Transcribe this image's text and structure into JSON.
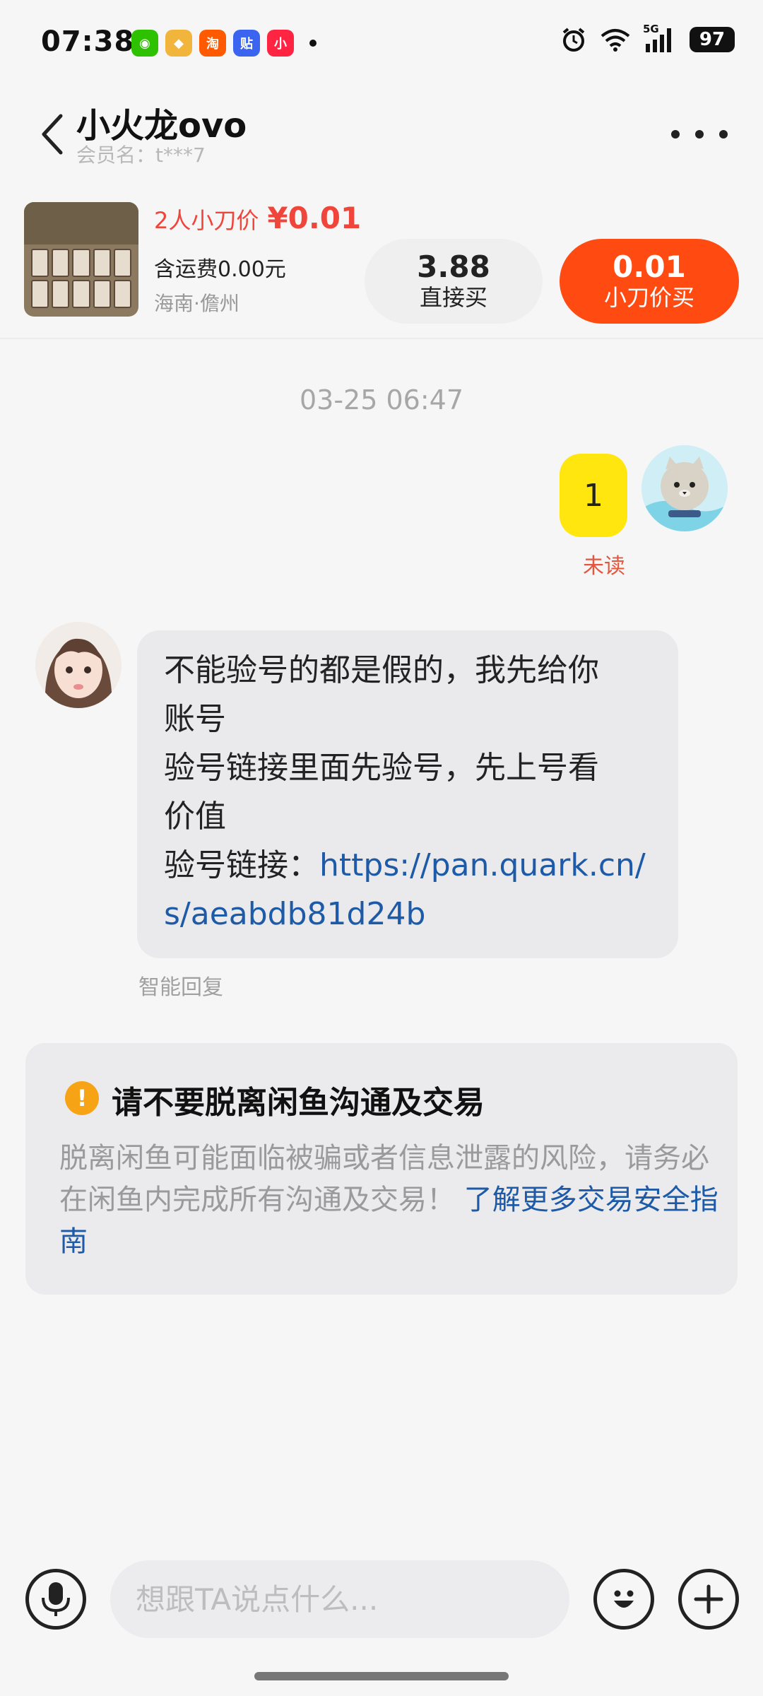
{
  "status_bar": {
    "time": "07:38",
    "apps": [
      {
        "icon": "wechat-icon",
        "color": "#2dc100",
        "glyph": "◉"
      },
      {
        "icon": "game-app-icon",
        "color": "#e94b3c",
        "glyph": "◆"
      },
      {
        "icon": "taobao-icon",
        "color": "#ff5a00",
        "glyph": "淘"
      },
      {
        "icon": "tieba-icon",
        "color": "#3b64f0",
        "glyph": "贴"
      },
      {
        "icon": "xiaohongshu-icon",
        "color": "#ff2442",
        "glyph": "小"
      }
    ],
    "network": "5G",
    "battery": "97"
  },
  "header": {
    "seller_name": "小火龙ovo",
    "member_label": "会员名：",
    "member_id": "t***7"
  },
  "product": {
    "bargain_label": "2人小刀价",
    "bargain_price": "¥0.01",
    "shipping": "含运费0.00元",
    "location": "海南·儋州",
    "direct_price": "3.88",
    "direct_label": "直接买",
    "bargain_button_price": "0.01",
    "bargain_button_label": "小刀价买"
  },
  "chat": {
    "timestamp": "03-25 06:47",
    "my_message": "1",
    "unread": "未读",
    "their_lines": [
      "不能验号的都是假的，我先给你",
      "账号",
      "验号链接里面先验号，先上号看",
      "价值"
    ],
    "link_prefix": "验号链接：",
    "link_line1": "https://pan.quark.cn/",
    "link_line2": "s/aeabdb81d24b",
    "smart_reply": "智能回复"
  },
  "warning": {
    "title": "请不要脱离闲鱼沟通及交易",
    "body": "脱离闲鱼可能面临被骗或者信息泄露的风险，请务必在闲鱼内完成所有沟通及交易！",
    "link": "了解更多交易安全指南"
  },
  "input": {
    "placeholder": "想跟TA说点什么..."
  },
  "colors": {
    "accent": "#ff4a12",
    "price_red": "#f0453a",
    "my_bubble": "#ffe60f",
    "link": "#1d5aa8"
  }
}
